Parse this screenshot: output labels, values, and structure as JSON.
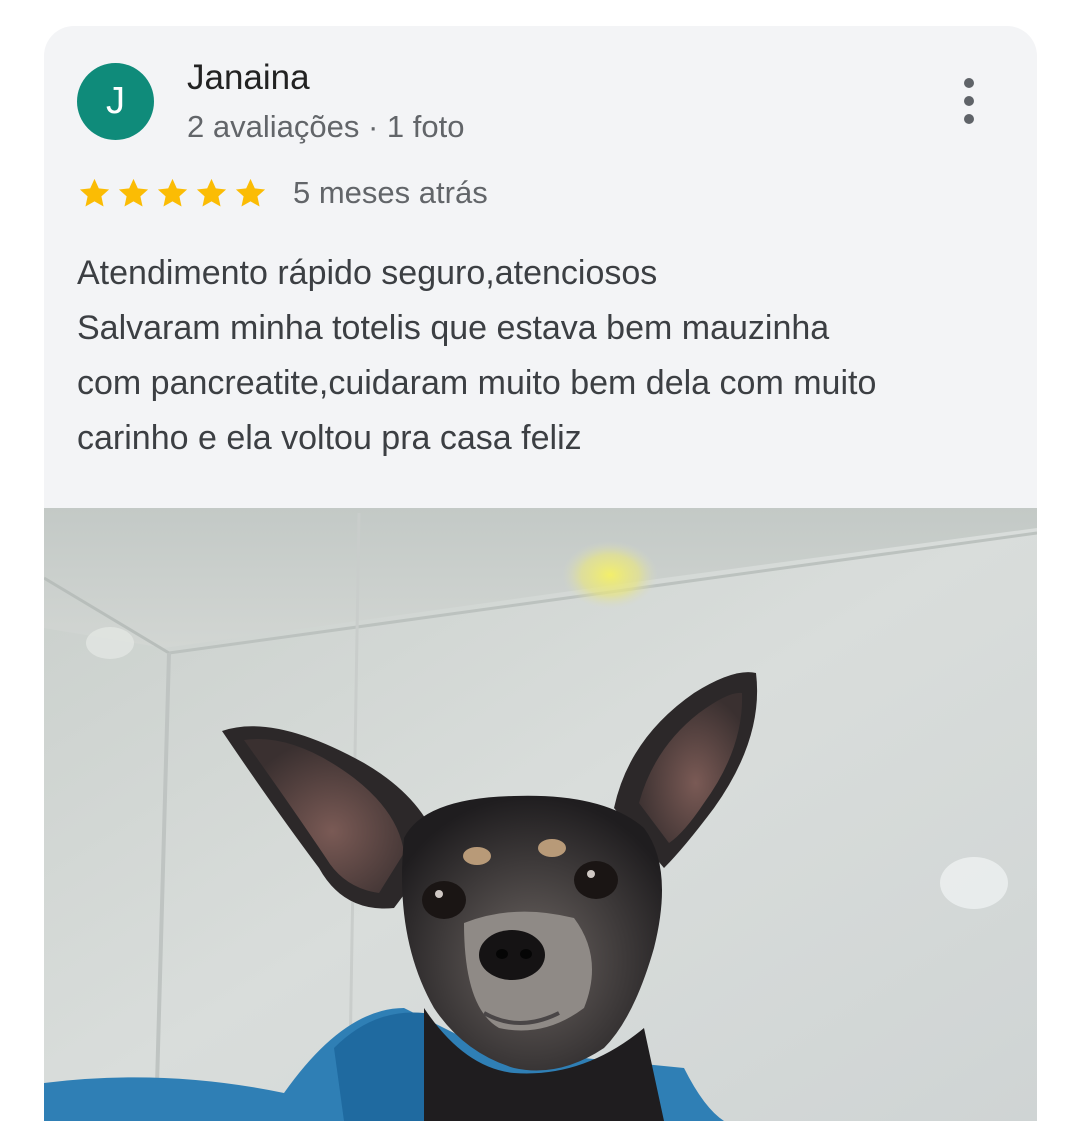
{
  "review": {
    "avatar_letter": "J",
    "author_name": "Janaina",
    "author_meta": "2 avaliações · 1 foto",
    "rating": 5,
    "rating_max": 5,
    "time_ago": "5 meses atrás",
    "text_lines": [
      "Atendimento rápido seguro,atenciosos",
      "Salvaram minha totelis que estava bem mauzinha",
      "com pancreatite,cuidaram muito bem dela com muito",
      "carinho e ela voltou pra casa feliz"
    ]
  },
  "icons": {
    "more": "more-vert-icon",
    "star": "star-icon"
  },
  "colors": {
    "avatar_bg": "#0f8b7a",
    "star": "#fbbc04",
    "card_bg": "#f3f4f6"
  }
}
